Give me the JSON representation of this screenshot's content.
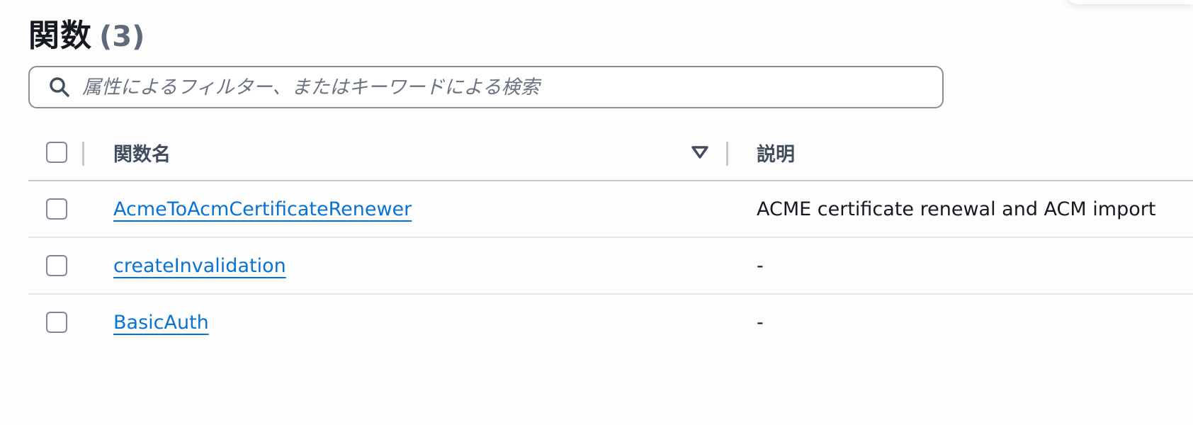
{
  "header": {
    "title": "関数",
    "count": "(3)"
  },
  "search": {
    "placeholder": "属性によるフィルター、またはキーワードによる検索",
    "icon": "search-icon"
  },
  "table": {
    "columns": {
      "name": "関数名",
      "description": "説明"
    },
    "sort_icon": "sort-descending-icon",
    "rows": [
      {
        "name": "AcmeToAcmCertificateRenewer",
        "description": "ACME certificate renewal and ACM import"
      },
      {
        "name": "createInvalidation",
        "description": "-"
      },
      {
        "name": "BasicAuth",
        "description": "-"
      }
    ]
  },
  "colors": {
    "link": "#0972d3",
    "text": "#16191f",
    "muted": "#5f6b7a",
    "border": "#8c8c94"
  }
}
